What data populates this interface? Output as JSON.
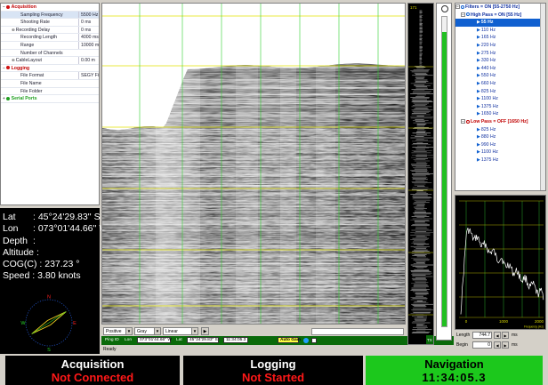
{
  "properties": {
    "acquisition": {
      "label": "Acquisition",
      "rows": [
        {
          "label": "Sampling Frequency",
          "value": "5500 Hz"
        },
        {
          "label": "Shooting Rate",
          "value": "0 ms"
        },
        {
          "label": "Recording Delay",
          "value": "0 ms",
          "expandable": true
        },
        {
          "label": "Recording Length",
          "value": "4000 ms"
        },
        {
          "label": "Range",
          "value": "10000 mV"
        },
        {
          "label": "Number of Channels",
          "value": ""
        },
        {
          "label": "CableLayout",
          "value": "0.00 m",
          "expandable": true
        }
      ]
    },
    "logging": {
      "label": "Logging",
      "rows": [
        {
          "label": "File Format",
          "value": "SEGY File"
        },
        {
          "label": "File Name",
          "value": ""
        },
        {
          "label": "File Folder",
          "value": ""
        }
      ]
    },
    "serial_ports": {
      "label": "Serial Ports"
    }
  },
  "navigation_info": {
    "lat_label": "Lat",
    "lat_value": ": 45°24'29.83'' S",
    "lon_label": "Lon",
    "lon_value": ": 073°01'44.66'' W",
    "depth_label": "Depth",
    "depth_value": ":",
    "altitude_label": "Altitude :",
    "cog_label": "COG(C) :",
    "cog_value": "237.23 °",
    "speed_label": "Speed :",
    "speed_value": "3.80 knots",
    "compass": {
      "n": "N",
      "e": "E",
      "s": "S",
      "w": "W",
      "heading_deg": 237.23
    }
  },
  "seismic_toolbar": {
    "polarity": "Positive",
    "palette": "Gray",
    "scale": "Linear",
    "play_icon": "play-icon"
  },
  "status_line": {
    "ping_label": "Ping ID",
    "lon_label": "Lon",
    "lon_value": "073°01'44.66'' W",
    "lat_label": "Lat",
    "lat_value": "45°24'29.83'' S",
    "time_value": "11:34:05.3",
    "autogain_label": "Auto Gain"
  },
  "ready_text": "Ready",
  "trace_labels": {
    "top": "171",
    "bottom": "TX"
  },
  "level": {
    "fraction": 0.95
  },
  "filters": {
    "root": "Filters = ON [55-2750 Hz]",
    "high_pass": "High Pass = ON [55 Hz]",
    "high_pass_items": [
      "55 Hz",
      "110 Hz",
      "165 Hz",
      "220 Hz",
      "275 Hz",
      "330 Hz",
      "440 Hz",
      "550 Hz",
      "660 Hz",
      "825 Hz",
      "1100 Hz",
      "1375 Hz",
      "1650 Hz"
    ],
    "high_pass_selected_index": 0,
    "low_pass": "Low Pass = OFF [1650 Hz]",
    "low_pass_items": [
      "825 Hz",
      "880 Hz",
      "990 Hz",
      "1100 Hz",
      "1375 Hz"
    ]
  },
  "spectrum": {
    "x_ticks": [
      "0",
      "1000",
      "2000"
    ],
    "x_unit": "Frequency (Hz)",
    "length_label": "Length",
    "length_value": "744.7",
    "begin_label": "Begin",
    "begin_value": "0",
    "unit": "ms"
  },
  "bottom_status": {
    "acquisition": {
      "title": "Acquisition",
      "state": "Not Connected"
    },
    "logging": {
      "title": "Logging",
      "state": "Not Started"
    },
    "navigation": {
      "title": "Navigation",
      "state": "11:34:05.3"
    }
  },
  "colors": {
    "nav_panel": "#1cc81c",
    "alert_text": "#ff1818",
    "status_green": "#0a6a0a",
    "filter_blue": "#1060d0"
  }
}
